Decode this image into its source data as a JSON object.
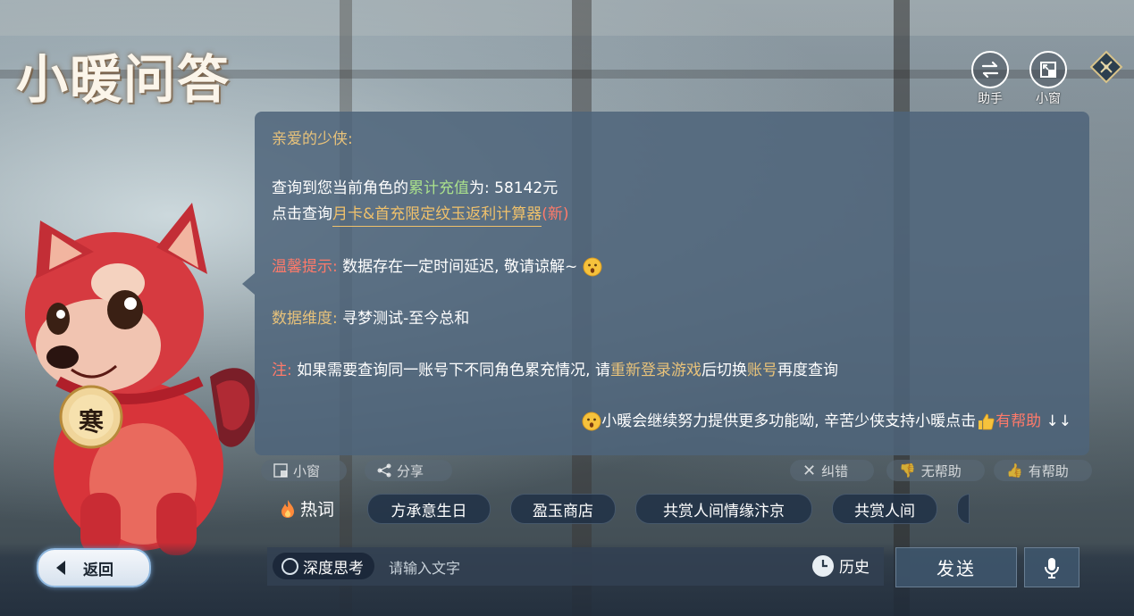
{
  "title": "小暖问答",
  "top_buttons": {
    "assistant_label": "助手",
    "small_window_label": "小窗"
  },
  "message": {
    "greeting": "亲爱的少侠:",
    "recharge_prefix": "查询到您当前角色的",
    "recharge_highlight": "累计充值",
    "recharge_suffix": "为: 58142元",
    "query_prefix": "点击查询",
    "query_link": "月卡&首充限定纹玉返利计算器",
    "query_new": "(新)",
    "tip_label": "温馨提示:",
    "tip_text": " 数据存在一定时间延迟, 敬请谅解~",
    "dimension_label": "数据维度:",
    "dimension_text": " 寻梦测试-至今总和",
    "note_label": "注:",
    "note_text_1": " 如果需要查询同一账号下不同角色累充情况, 请",
    "note_highlight_1": "重新登录游戏",
    "note_text_2": "后切换",
    "note_highlight_2": "账号",
    "note_text_3": "再度查询",
    "footer_text": "小暖会继续努力提供更多功能呦, 辛苦少侠支持小暖点击",
    "footer_highlight": "有帮助",
    "footer_arrows": "↓↓"
  },
  "actions": {
    "small_window": "小窗",
    "share": "分享",
    "correct": "纠错",
    "not_helpful": "无帮助",
    "helpful": "有帮助"
  },
  "hot_words": {
    "label": "热词",
    "items": [
      "方承意生日",
      "盈玉商店",
      "共赏人间情缘汴京",
      "共赏人间"
    ]
  },
  "bottom": {
    "back": "返回",
    "deep_think": "深度思考",
    "input_placeholder": "请输入文字",
    "history": "历史",
    "send": "发送"
  },
  "mascot": {
    "tag_char": "寒"
  },
  "colors": {
    "panel_bg": "#4e647a",
    "gold_text": "#e8c27a",
    "green_text": "#a9e08c",
    "red_text": "#ff7a6a",
    "mascot_red": "#d8343a"
  }
}
